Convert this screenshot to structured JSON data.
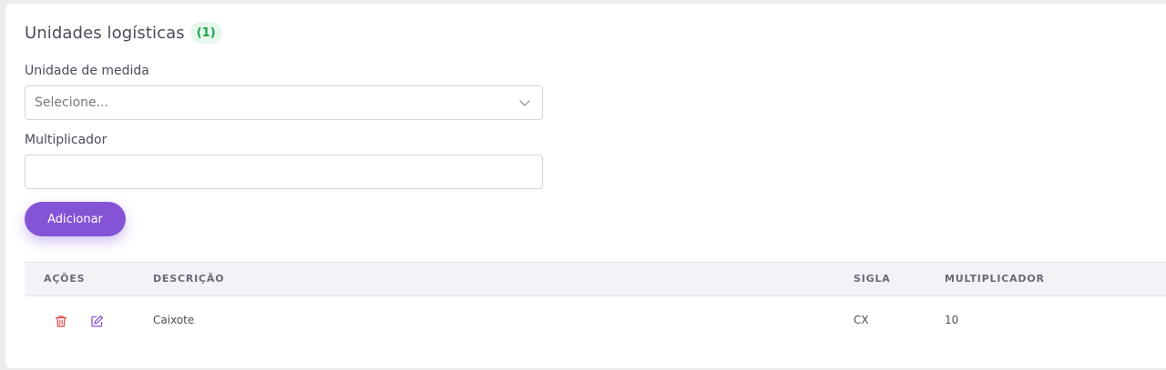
{
  "section": {
    "title": "Unidades logísticas",
    "count": "(1)"
  },
  "form": {
    "unit_label": "Unidade de medida",
    "unit_placeholder": "Selecione...",
    "multiplier_label": "Multiplicador",
    "multiplier_value": "",
    "add_button": "Adicionar"
  },
  "table": {
    "headers": [
      "AÇÕES",
      "DESCRIÇÃO",
      "SIGLA",
      "MULTIPLICADOR"
    ],
    "rows": [
      {
        "descricao": "Caixote",
        "sigla": "CX",
        "multiplicador": "10"
      }
    ]
  },
  "icons": {
    "delete": "trash-icon",
    "edit": "edit-icon",
    "dropdown": "chevron-down-icon"
  },
  "colors": {
    "accent": "#8553d6",
    "badge_bg": "#e6f7ec",
    "badge_text": "#1fa34a",
    "delete": "#e04848"
  }
}
